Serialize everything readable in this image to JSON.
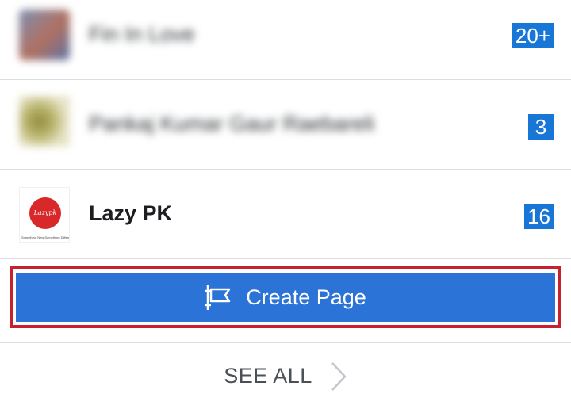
{
  "pages": [
    {
      "name": "Fin In Love",
      "badge": "20+",
      "blurred": true
    },
    {
      "name": "Pankaj Kumar Gaur Raebareli",
      "badge": "3",
      "blurred": true
    },
    {
      "name": "Lazy PK",
      "badge": "16",
      "blurred": false,
      "logo_text": "Lazypk",
      "logo_tagline": "Something New Something Different"
    }
  ],
  "create_page": {
    "label": "Create Page",
    "icon": "flag-icon"
  },
  "see_all": {
    "label": "SEE ALL",
    "icon": "chevron-right-icon"
  },
  "colors": {
    "badge": "#1877d6",
    "button": "#2b73d6",
    "highlight_border": "#c8202e",
    "divider": "#dadde1"
  }
}
